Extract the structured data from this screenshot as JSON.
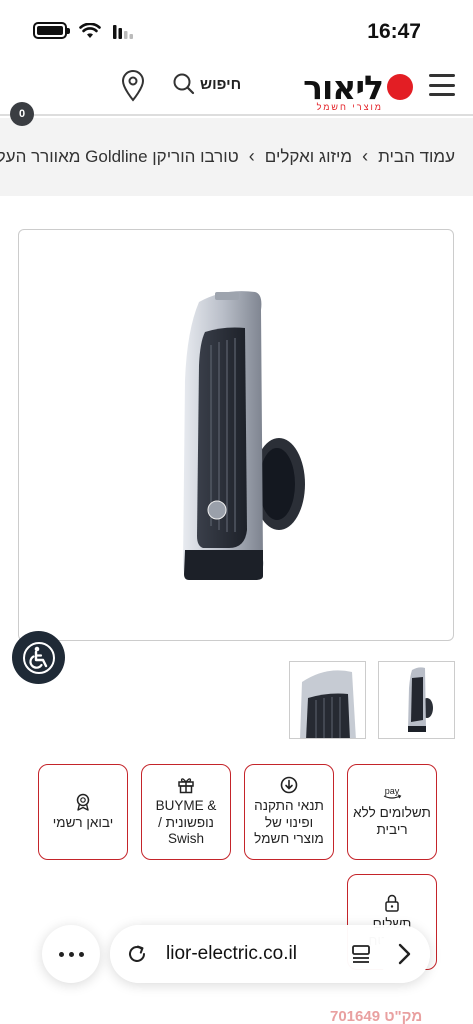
{
  "status_bar": {
    "time": "16:47"
  },
  "header": {
    "logo_text": "ליאור",
    "logo_tagline": "מוצרי חשמל",
    "search_label": "חיפוש",
    "cart_count": "0",
    "colors": {
      "brand_red": "#e31e24",
      "dark": "#3a3d42"
    }
  },
  "breadcrumb": {
    "items": [
      "עמוד הבית",
      "מיזוג ואקלים",
      "מאוורר העל Goldline טורבו הוריקן"
    ]
  },
  "product": {
    "image_icon": "tower-fan-image",
    "thumbnails": [
      "tower-fan-thumb-1",
      "tower-fan-thumb-2"
    ]
  },
  "features": [
    {
      "icon": "pay-icon",
      "icon_text": "pay",
      "text": "תשלומים ללא ריבית"
    },
    {
      "icon": "download-circle-icon",
      "text": "תנאי התקנה ופינוי של מוצרי חשמל"
    },
    {
      "icon": "gift-icon",
      "text": "& BUYME נופשונית / Swish"
    },
    {
      "icon": "award-icon",
      "text": "יבואן רשמי"
    },
    {
      "icon": "lock-icon",
      "text": "תשלום מאובטח"
    }
  ],
  "browser": {
    "url": "lior-electric.co.il"
  },
  "price_peek": "מק\"ט 701649"
}
